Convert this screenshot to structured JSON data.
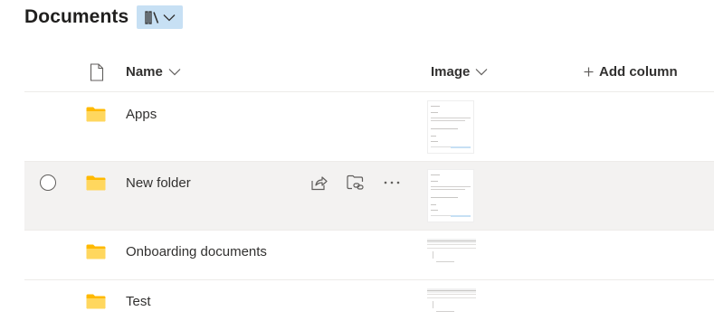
{
  "library": {
    "title": "Documents"
  },
  "view_switcher": {
    "icon": "library-view-icon",
    "chevron": "chevron-down-icon"
  },
  "columns": {
    "file_type_icon": "document-icon",
    "name": "Name",
    "image": "Image",
    "add_column": "Add column"
  },
  "rows": [
    {
      "name": "Apps",
      "icon": "folder-icon",
      "selected": false
    },
    {
      "name": "New folder",
      "icon": "folder-icon",
      "selected": false,
      "hovered": true,
      "actions": [
        "share-icon",
        "copy-link-icon",
        "more-options-icon"
      ]
    },
    {
      "name": "Onboarding documents",
      "icon": "folder-icon",
      "selected": false
    },
    {
      "name": "Test",
      "icon": "folder-icon",
      "selected": false
    }
  ],
  "colors": {
    "hover_row": "#f3f2f1",
    "view_button": "#c7e0f4",
    "folder": "#ffb900"
  }
}
